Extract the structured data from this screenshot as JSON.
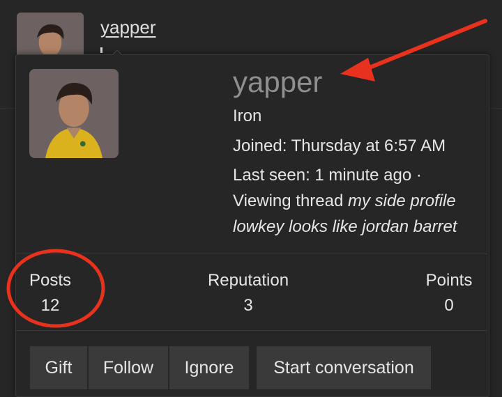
{
  "background": {
    "username": "yapper"
  },
  "card": {
    "username": "yapper",
    "rank": "Iron",
    "joined": "Joined: Thursday at 6:57 AM",
    "last_seen": "Last seen: 1 minute ago ·",
    "viewing_prefix": "Viewing thread ",
    "viewing_title_part1": "my side profile",
    "viewing_title_part2": "lowkey looks like jordan barret"
  },
  "stats": [
    {
      "label": "Posts",
      "value": "12"
    },
    {
      "label": "Reputation",
      "value": "3"
    },
    {
      "label": "Points",
      "value": "0"
    }
  ],
  "buttons": {
    "gift": "Gift",
    "follow": "Follow",
    "ignore": "Ignore",
    "start_conversation": "Start conversation"
  },
  "colors": {
    "annotation": "#e8321e",
    "background": "#262626",
    "button": "#3a3a3a"
  }
}
